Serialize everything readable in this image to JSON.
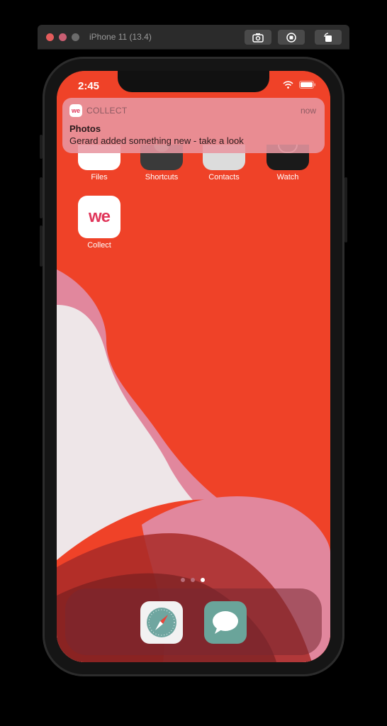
{
  "simulator": {
    "title": "iPhone 11 (13.4)",
    "toolbar_buttons": [
      "screenshot-icon",
      "home-icon",
      "rotate-icon"
    ]
  },
  "status_bar": {
    "time": "2:45",
    "icons": [
      "wifi-icon",
      "battery-icon"
    ]
  },
  "notification": {
    "app_name": "COLLECT",
    "time": "now",
    "title": "Photos",
    "body": "Gerard added something new - take a look",
    "icon_text": "we"
  },
  "home_apps": [
    {
      "label": "Files",
      "icon": "files-icon",
      "color": "#ffffff"
    },
    {
      "label": "Shortcuts",
      "icon": "shortcuts-icon",
      "color": "#3a3a3a"
    },
    {
      "label": "Contacts",
      "icon": "contacts-icon",
      "color": "#dcdcdc"
    },
    {
      "label": "Watch",
      "icon": "watch-icon",
      "color": "#1a1a1a"
    },
    {
      "label": "Collect",
      "icon": "collect-icon",
      "color": "#ffffff",
      "icon_text": "we"
    }
  ],
  "page_dots": {
    "count": 3,
    "active_index": 2
  },
  "dock_apps": [
    {
      "name": "safari",
      "icon": "safari-icon"
    },
    {
      "name": "messages",
      "icon": "messages-icon"
    }
  ],
  "colors": {
    "wallpaper": "#ef4228",
    "wallpaper_pink": "#e1879d",
    "wallpaper_light": "#eee6e8",
    "collect_brand": "#e0365a",
    "messages_green": "#6aa49a",
    "safari_blue": "#6fa6a0"
  }
}
